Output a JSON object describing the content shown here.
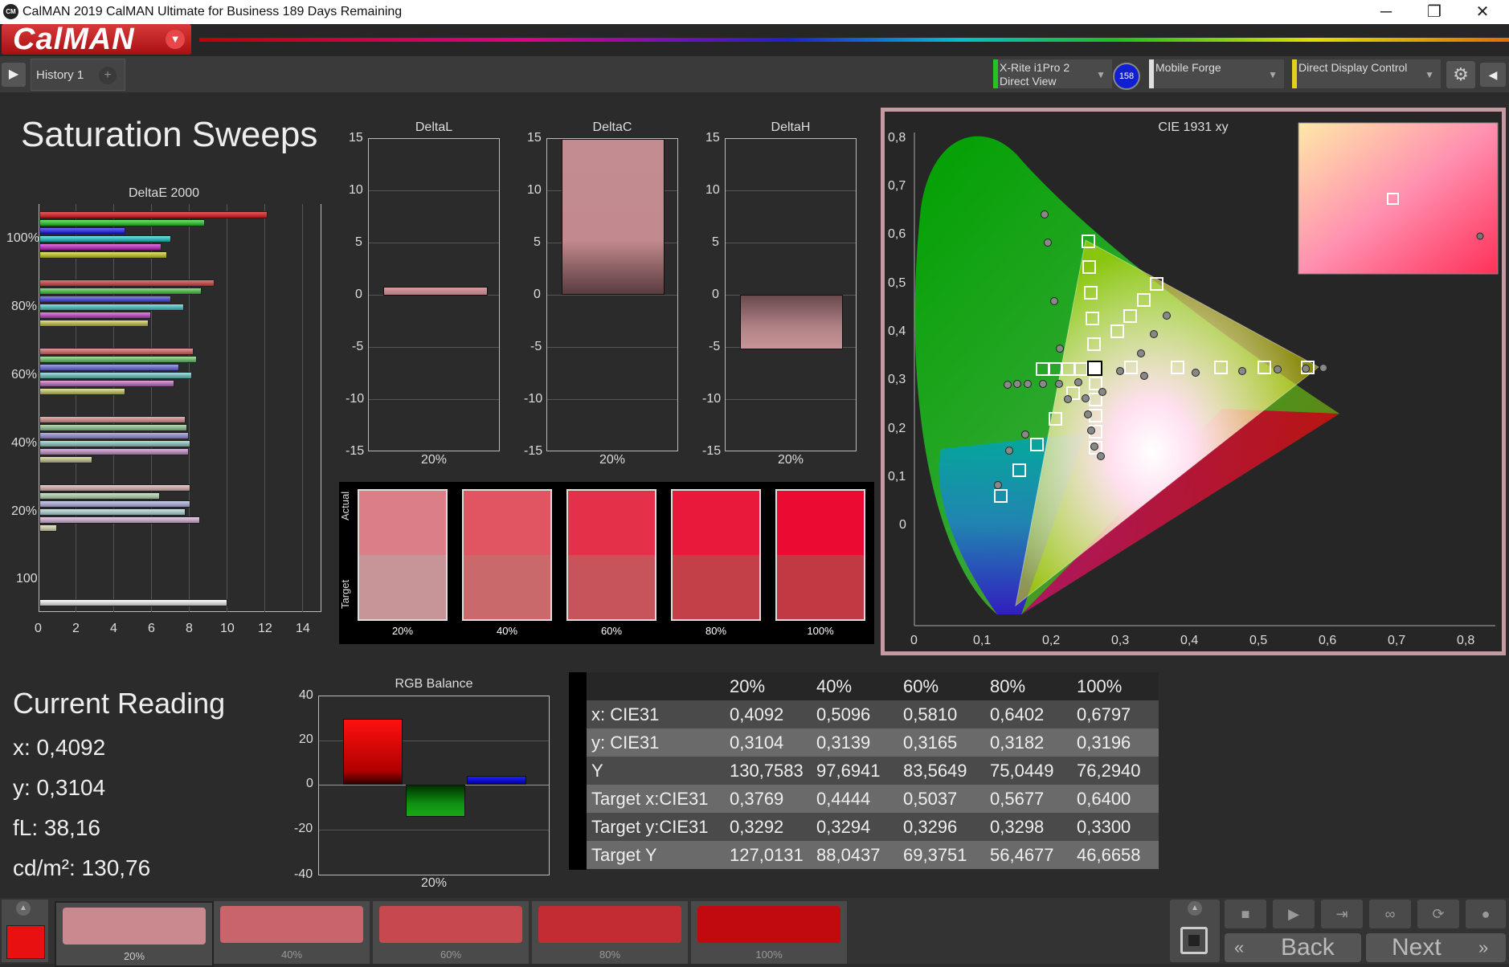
{
  "window": {
    "title": "CalMAN 2019 CalMAN Ultimate for Business 189 Days Remaining",
    "app_icon": "CM",
    "controls": [
      "─",
      "❐",
      "✕"
    ]
  },
  "brand": {
    "logo": "CalMAN"
  },
  "tabs": {
    "history_tab": "History 1",
    "add_tab": "+"
  },
  "devices": {
    "meter": {
      "line1": "X-Rite i1Pro 2",
      "line2": "Direct View",
      "badge": "158",
      "color": "#22c522"
    },
    "source": {
      "line1": "Mobile Forge",
      "color": "#e0e0e0"
    },
    "display": {
      "line1": "Direct Display Control",
      "color": "#e0d020"
    }
  },
  "page_title": "Saturation Sweeps",
  "deltae": {
    "title": "DeltaE 2000",
    "x_ticks": [
      "0",
      "2",
      "4",
      "6",
      "8",
      "10",
      "12",
      "14"
    ],
    "y_labels": [
      "100%",
      "80%",
      "60%",
      "40%",
      "20%",
      "100"
    ]
  },
  "delta_charts": [
    {
      "title": "DeltaL",
      "x_label": "20%",
      "value": 0.7
    },
    {
      "title": "DeltaC",
      "x_label": "20%",
      "value": 15
    },
    {
      "title": "DeltaH",
      "x_label": "20%",
      "value": -5.3
    }
  ],
  "delta_ticks": [
    "15",
    "10",
    "5",
    "0",
    "-5",
    "-10",
    "-15"
  ],
  "swatches": {
    "actual_label": "Actual",
    "target_label": "Target",
    "items": [
      {
        "label": "20%",
        "actual": "#dc7e88",
        "target": "#c79598"
      },
      {
        "label": "40%",
        "actual": "#e15562",
        "target": "#c9696b"
      },
      {
        "label": "60%",
        "actual": "#e5304a",
        "target": "#c6545a"
      },
      {
        "label": "80%",
        "actual": "#e8193a",
        "target": "#c44049"
      },
      {
        "label": "100%",
        "actual": "#ea0a32",
        "target": "#c13a43"
      }
    ]
  },
  "cie": {
    "title": "CIE 1931 xy",
    "x_ticks": [
      "0",
      "0,1",
      "0,2",
      "0,3",
      "0,4",
      "0,5",
      "0,6",
      "0,7",
      "0,8"
    ],
    "y_ticks": [
      "0,8",
      "0,7",
      "0,6",
      "0,5",
      "0,4",
      "0,3",
      "0,2",
      "0,1",
      "0"
    ]
  },
  "current_reading": {
    "title": "Current Reading",
    "x": "x: 0,4092",
    "y": "y: 0,3104",
    "fl": "fL: 38,16",
    "cdm2": "cd/m²: 130,76"
  },
  "rgb_balance": {
    "title": "RGB Balance",
    "y_ticks": [
      "40",
      "20",
      "0",
      "-20",
      "-40"
    ],
    "x_label": "20%",
    "values": {
      "red": 30,
      "green": -14,
      "blue": 4
    }
  },
  "table": {
    "columns": [
      "",
      "20%",
      "40%",
      "60%",
      "80%",
      "100%"
    ],
    "rows": [
      [
        "x: CIE31",
        "0,4092",
        "0,5096",
        "0,5810",
        "0,6402",
        "0,6797"
      ],
      [
        "y: CIE31",
        "0,3104",
        "0,3139",
        "0,3165",
        "0,3182",
        "0,3196"
      ],
      [
        "Y",
        "130,7583",
        "97,6941",
        "83,5649",
        "75,0449",
        "76,2940"
      ],
      [
        "Target x:CIE31",
        "0,3769",
        "0,4444",
        "0,5037",
        "0,5677",
        "0,6400"
      ],
      [
        "Target y:CIE31",
        "0,3292",
        "0,3294",
        "0,3296",
        "0,3298",
        "0,3300"
      ],
      [
        "Target Y",
        "127,0131",
        "88,0437",
        "69,3751",
        "56,4677",
        "46,6658"
      ]
    ]
  },
  "bottom": {
    "tiles": [
      {
        "label": "20%",
        "color": "#c9898e"
      },
      {
        "label": "40%",
        "color": "#c9646a"
      },
      {
        "label": "60%",
        "color": "#c7484e"
      },
      {
        "label": "80%",
        "color": "#c42c33"
      },
      {
        "label": "100%",
        "color": "#c00a10"
      }
    ],
    "back": "Back",
    "next": "Next"
  }
}
